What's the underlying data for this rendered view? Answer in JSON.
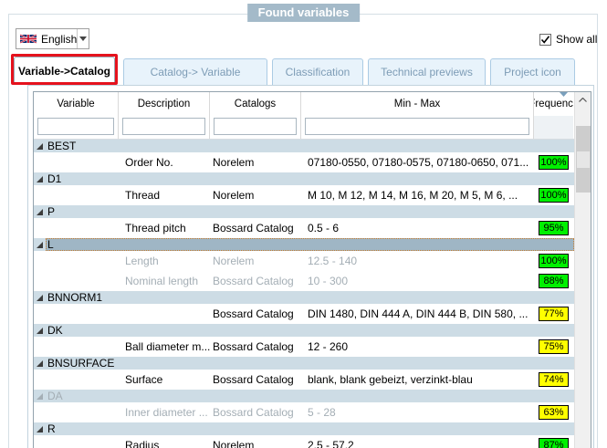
{
  "window": {
    "group_title": "Found variables"
  },
  "toolbar": {
    "language": {
      "value": "English",
      "flag_icon": "uk-flag-icon",
      "arrow_icon": "dropdown-arrow-icon"
    },
    "show_all": {
      "label": "Show all",
      "checked": true,
      "check_icon": "checkmark-icon"
    }
  },
  "tabs": [
    {
      "label": "Variable->Catalog",
      "active": true,
      "highlighted_red": true
    },
    {
      "label": "Catalog-> Variable",
      "active": false
    },
    {
      "label": "Classification",
      "active": false
    },
    {
      "label": "Technical previews",
      "active": false
    },
    {
      "label": "Project icon",
      "active": false
    }
  ],
  "table": {
    "columns": [
      "Variable",
      "Description",
      "Catalogs",
      "Min - Max",
      "Frequency"
    ],
    "filter_values": [
      "",
      "",
      "",
      ""
    ],
    "frequency_filter_icon": "filter-arrow-icon",
    "rows": [
      {
        "type": "group",
        "label": "BEST",
        "selected": false,
        "dimmed": false
      },
      {
        "type": "data",
        "description": "Order No.",
        "catalogs": "Norelem",
        "minmax": "07180-0550, 07180-0575, 07180-0650, 071...",
        "frequency": "100%",
        "freq_color": "green",
        "dimmed": false
      },
      {
        "type": "group",
        "label": "D1",
        "selected": false,
        "dimmed": false
      },
      {
        "type": "data",
        "description": "Thread",
        "catalogs": "Norelem",
        "minmax": "M 10, M 12, M 14, M 16, M 20, M 5, M 6, ...",
        "frequency": "100%",
        "freq_color": "green",
        "dimmed": false
      },
      {
        "type": "group",
        "label": "P",
        "selected": false,
        "dimmed": false
      },
      {
        "type": "data",
        "description": "Thread pitch",
        "catalogs": "Bossard Catalog",
        "minmax": "0.5 - 6",
        "frequency": "95%",
        "freq_color": "green",
        "dimmed": false
      },
      {
        "type": "group",
        "label": "L",
        "selected": true,
        "dimmed": false
      },
      {
        "type": "data",
        "description": "Length",
        "catalogs": "Norelem",
        "minmax": "12.5 - 140",
        "frequency": "100%",
        "freq_color": "green",
        "dimmed": true
      },
      {
        "type": "data",
        "description": "Nominal length",
        "catalogs": "Bossard Catalog",
        "minmax": "10 - 300",
        "frequency": "88%",
        "freq_color": "green",
        "dimmed": true
      },
      {
        "type": "group",
        "label": "BNNORM1",
        "selected": false,
        "dimmed": false
      },
      {
        "type": "data",
        "description": "",
        "catalogs": "Bossard Catalog",
        "minmax": "DIN 1480, DIN 444 A, DIN 444 B, DIN 580, ...",
        "frequency": "77%",
        "freq_color": "yellow",
        "dimmed": false
      },
      {
        "type": "group",
        "label": "DK",
        "selected": false,
        "dimmed": false
      },
      {
        "type": "data",
        "description": "Ball diameter m...",
        "catalogs": "Bossard Catalog",
        "minmax": "12 - 260",
        "frequency": "75%",
        "freq_color": "yellow",
        "dimmed": false
      },
      {
        "type": "group",
        "label": "BNSURFACE",
        "selected": false,
        "dimmed": false
      },
      {
        "type": "data",
        "description": "Surface",
        "catalogs": "Bossard Catalog",
        "minmax": "blank, blank gebeizt, verzinkt-blau",
        "frequency": "74%",
        "freq_color": "yellow",
        "dimmed": false
      },
      {
        "type": "group",
        "label": "DA",
        "selected": false,
        "dimmed": true
      },
      {
        "type": "data",
        "description": "Inner diameter ...",
        "catalogs": "Bossard Catalog",
        "minmax": "5 - 28",
        "frequency": "63%",
        "freq_color": "yellow",
        "dimmed": true
      },
      {
        "type": "group",
        "label": "R",
        "selected": false,
        "dimmed": false
      },
      {
        "type": "data",
        "description": "Radius",
        "catalogs": "Norelem",
        "minmax": "2.5 - 57.2",
        "frequency": "87%",
        "freq_color": "green",
        "dimmed": false
      }
    ]
  },
  "colors": {
    "freq_green": "#00f000",
    "freq_yellow": "#ffff00",
    "highlight_red": "#e5121d",
    "group_row_bg": "#cddce5",
    "selected_row_bg": "#9fb6c5",
    "selected_outline": "#c87d2e",
    "title_chip_bg": "#a4bac9",
    "tab_inactive_bg": "#e8f3fb",
    "dimmed_text": "#a4aeb5"
  },
  "icons": {
    "uk-flag-icon": "union-jack",
    "dropdown-arrow-icon": "▾",
    "checkmark-icon": "✓",
    "expander-icon": "◢ (expanded group triangle)",
    "filter-arrow-icon": "▾",
    "chevron-up-icon": "˄"
  }
}
